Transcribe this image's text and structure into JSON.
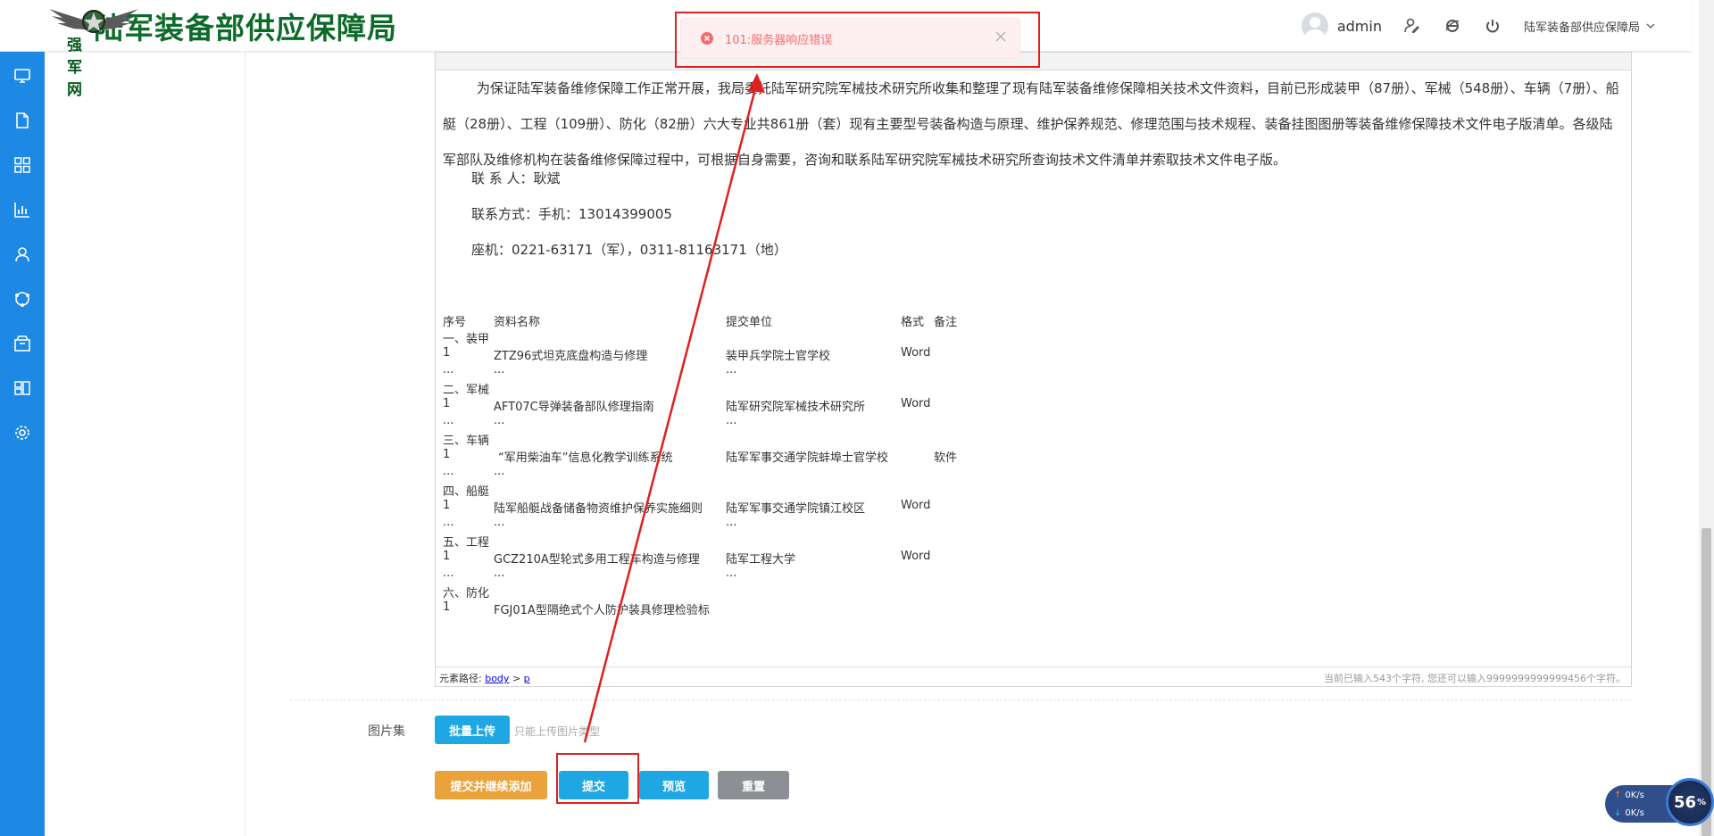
{
  "header": {
    "logo_small_text": "强军网",
    "site_title": "陆军装备部供应保障局",
    "username": "admin",
    "org_menu_label": "陆军装备部供应保障局"
  },
  "sidebar": {
    "icons": [
      "monitor-icon",
      "document-icon",
      "grid-icon",
      "bar-chart-icon",
      "user-icon",
      "support-icon",
      "box-icon",
      "dashboard-icon",
      "settings-icon"
    ]
  },
  "toast": {
    "message": "101:服务器响应错误",
    "color": "#f56c6c"
  },
  "editor": {
    "intro_paragraph": "为保证陆军装备维修保障工作正常开展，我局委托陆军研究院军械技术研究所收集和整理了现有陆军装备维修保障相关技术文件资料，目前已形成装甲（87册）、军械（548册）、车辆（7册）、船艇（28册）、工程（109册）、防化（82册）六大专业共861册（套）现有主要型号装备构造与原理、维护保养规范、修理范围与技术规程、装备挂图图册等装备维修保障技术文件电子版清单。各级陆军部队及维修机构在装备维修保障过程中，可根据自身需要，咨询和联系陆军研究院军械技术研究所查询技术文件清单并索取技术文件电子版。",
    "contact_person": "联 系 人：耿斌",
    "contact_phone": "联系方式：手机：13014399005",
    "contact_landline": "座机：0221-63171（军），0311-81163171（地）",
    "table": {
      "headers": [
        "序号",
        "资料名称",
        "提交单位",
        "格式",
        "备注"
      ],
      "sections": [
        {
          "title": "一、装甲",
          "no": "1",
          "name": "ZTZ96式坦克底盘构造与修理",
          "unit": "装甲兵学院士官学校",
          "format": "Word",
          "ellipsis": "..."
        },
        {
          "title": "二、军械",
          "no": "1",
          "name": "AFT07C导弹装备部队修理指南",
          "unit": "陆军研究院军械技术研究所",
          "format": "Word",
          "ellipsis": "..."
        },
        {
          "title": "三、车辆",
          "no": "1",
          "name": "“军用柴油车”信息化教学训练系统",
          "unit": "陆军军事交通学院蚌埠士官学校",
          "format": "软件",
          "ellipsis": "..."
        },
        {
          "title": "四、船艇",
          "no": "1",
          "name": "陆军船艇战备储备物资维护保养实施细则",
          "unit": "陆军军事交通学院镇江校区",
          "format": "Word",
          "ellipsis": "..."
        },
        {
          "title": "五、工程",
          "no": "1",
          "name": "GCZ210A型轮式多用工程车构造与修理",
          "unit": "陆军工程大学",
          "format": "Word",
          "ellipsis": "..."
        },
        {
          "title": "六、防化",
          "no": "1",
          "name": "FGJ01A型隔绝式个人防护装具修理检验标",
          "unit": "",
          "format": "",
          "ellipsis": ""
        }
      ]
    },
    "path_prefix": "元素路径:",
    "path_body": "body",
    "path_sep": ">",
    "path_p": "p",
    "char_count": "当前已输入543个字符, 您还可以输入9999999999999456个字符。"
  },
  "form": {
    "gallery_label": "图片集",
    "batch_upload_label": "批量上传",
    "upload_hint": "只能上传图片类型",
    "submit_continue_label": "提交并继续添加",
    "submit_label": "提交",
    "preview_label": "预览",
    "reset_label": "重置"
  },
  "speed_widget": {
    "upload_rate": "0K/s",
    "download_rate": "0K/s",
    "percent": "56",
    "percent_sign": "%"
  },
  "colors": {
    "sidebar": "#1e88e5",
    "primary_button": "#1fa7e4",
    "warning_button": "#eaa23a",
    "reset_button": "#8c8f94",
    "annotation": "#e02020"
  }
}
